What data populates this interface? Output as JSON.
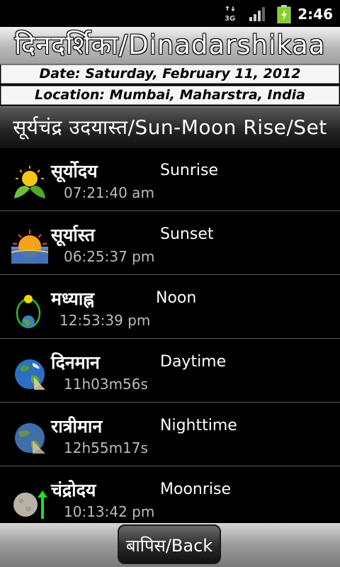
{
  "status_bar": {
    "network_label": "3G",
    "time": "2:46",
    "icons": [
      "network-3g-icon",
      "signal-icon",
      "battery-charging-icon"
    ]
  },
  "title": "दिनदर्शिका/Dinadarshikaa",
  "info": {
    "date": "Date: Saturday, February 11, 2012",
    "location": "Location: Mumbai, Maharstra, India"
  },
  "section_title": "सूर्यचंद्र उदयास्त/Sun-Moon Rise/Set",
  "rows": [
    {
      "hindi": "सूर्योदय",
      "english": "Sunrise",
      "value": "07:21:40 am",
      "icon": "sunrise-icon"
    },
    {
      "hindi": "सूर्यास्त",
      "english": "Sunset",
      "value": "06:25:37 pm",
      "icon": "sunset-icon"
    },
    {
      "hindi": "मध्याह्न",
      "english": "Noon",
      "value": "12:53:39 pm",
      "icon": "noon-icon"
    },
    {
      "hindi": "दिनमान",
      "english": "Daytime",
      "value": "11h03m56s",
      "icon": "earth-day-icon"
    },
    {
      "hindi": "रात्रीमान",
      "english": "Nighttime",
      "value": "12h55m17s",
      "icon": "earth-night-icon"
    },
    {
      "hindi": "चंद्रोदय",
      "english": "Moonrise",
      "value": "10:13:42 pm",
      "icon": "moonrise-icon"
    }
  ],
  "back_label": "बापिस/Back",
  "colors": {
    "background": "#000000",
    "secondary_text": "#bbbbbb",
    "moonrise_arrow": "#22dd22",
    "battery": "#7ed321"
  }
}
